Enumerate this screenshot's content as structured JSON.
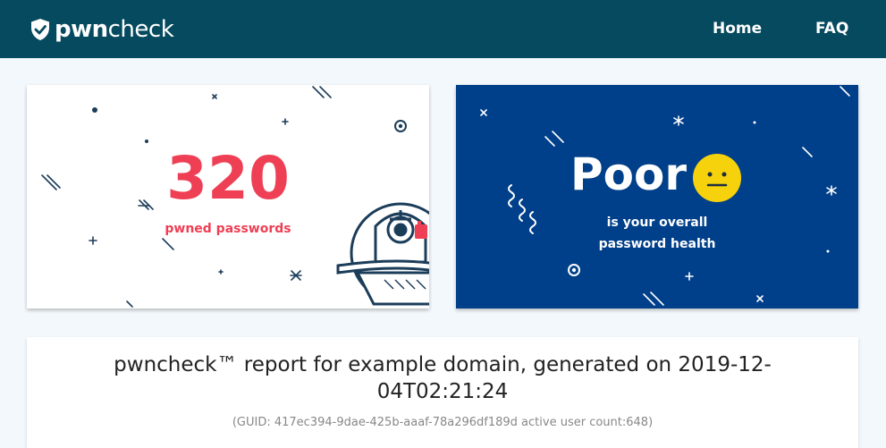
{
  "brand": {
    "name_bold": "pwn",
    "name_light": "check",
    "logo_icon": "shield-check-icon"
  },
  "nav": {
    "home": "Home",
    "faq": "FAQ"
  },
  "colors": {
    "navbar": "#064a5f",
    "accent_red": "#ef3f54",
    "health_card": "#003f89",
    "face_yellow": "#f5d20b"
  },
  "pwned": {
    "count": "320",
    "label": "pwned passwords"
  },
  "health": {
    "rating": "Poor",
    "face_icon": "neutral-face-icon",
    "caption_line1": "is your overall",
    "caption_line2": "password health"
  },
  "report": {
    "title_line1": "pwncheck™ report for example domain, generated on 2019-12-",
    "title_line2": "04T02:21:24",
    "guid_line": "(GUID: 417ec394-9dae-425b-aaaf-78a296df189d active user count:648)"
  }
}
